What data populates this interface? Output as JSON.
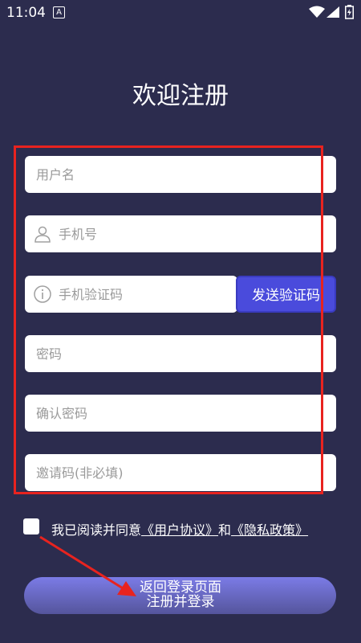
{
  "status_bar": {
    "time": "11:04",
    "notification_glyph": "A"
  },
  "page_title": "欢迎注册",
  "fields": {
    "username": {
      "placeholder": "用户名"
    },
    "phone": {
      "placeholder": "手机号",
      "icon": "user-icon"
    },
    "sms_code": {
      "placeholder": "手机验证码",
      "icon": "info-icon"
    },
    "password": {
      "placeholder": "密码"
    },
    "confirm_password": {
      "placeholder": "确认密码"
    },
    "invite_code": {
      "placeholder": "邀请码(非必填)"
    }
  },
  "send_code_button": "发送验证码",
  "agreement": {
    "prefix": "我已阅读并同意",
    "user_agreement": "《用户协议》",
    "and": "和",
    "privacy_policy": "《隐私政策》"
  },
  "back_to_login": "返回登录页面",
  "submit_button": "注册并登录",
  "annotation_color": "#e8231f"
}
